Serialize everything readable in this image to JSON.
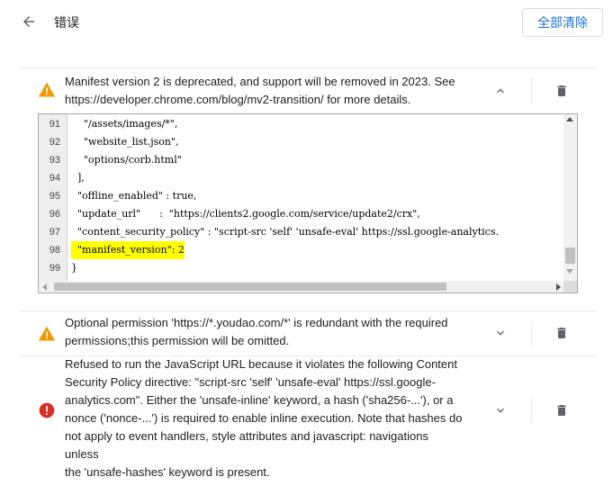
{
  "header": {
    "title": "错误",
    "clear_all_label": "全部清除"
  },
  "errors": [
    {
      "severity": "warning",
      "expanded": true,
      "message": "Manifest version 2 is deprecated, and support will be removed in 2023. See https://developer.chrome.com/blog/mv2-transition/ for more details.",
      "message_lines": [
        "Manifest version 2 is deprecated, and support will be removed in 2023. See",
        "https://developer.chrome.com/blog/mv2-transition/ for more details."
      ],
      "code": [
        {
          "line": "91",
          "text": "    \"/assets/images/*\","
        },
        {
          "line": "92",
          "text": "    \"website_list.json\","
        },
        {
          "line": "93",
          "text": "    \"options/corb.html\""
        },
        {
          "line": "94",
          "text": "  ],"
        },
        {
          "line": "95",
          "text": "  \"offline_enabled\" : true,"
        },
        {
          "line": "96",
          "text": "  \"update_url\"      :  \"https://clients2.google.com/service/update2/crx\","
        },
        {
          "line": "97",
          "text": "  \"content_security_policy\" : \"script-src 'self' 'unsafe-eval' https://ssl.google-analytics."
        },
        {
          "line": "98",
          "text": "  \"manifest_version\": 2",
          "highlight": true
        },
        {
          "line": "99",
          "text": "}"
        }
      ]
    },
    {
      "severity": "warning",
      "expanded": false,
      "message_lines": [
        "Optional permission 'https://*.youdao.com/*' is redundant with the required",
        "permissions;this permission will be omitted."
      ]
    },
    {
      "severity": "error",
      "expanded": false,
      "message_lines": [
        "Refused to run the JavaScript URL because it violates the following Content",
        "Security Policy directive: \"script-src 'self' 'unsafe-eval' https://ssl.google-",
        "analytics.com\". Either the 'unsafe-inline' keyword, a hash ('sha256-...'), or a",
        "nonce ('nonce-...') is required to enable inline execution. Note that hashes do",
        "not apply to event handlers, style attributes and javascript: navigations unless",
        "the 'unsafe-hashes' keyword is present."
      ]
    }
  ],
  "colors": {
    "accent": "#1a73e8",
    "warning": "#f29900",
    "error": "#d93025",
    "icon_gray": "#5f6368"
  }
}
